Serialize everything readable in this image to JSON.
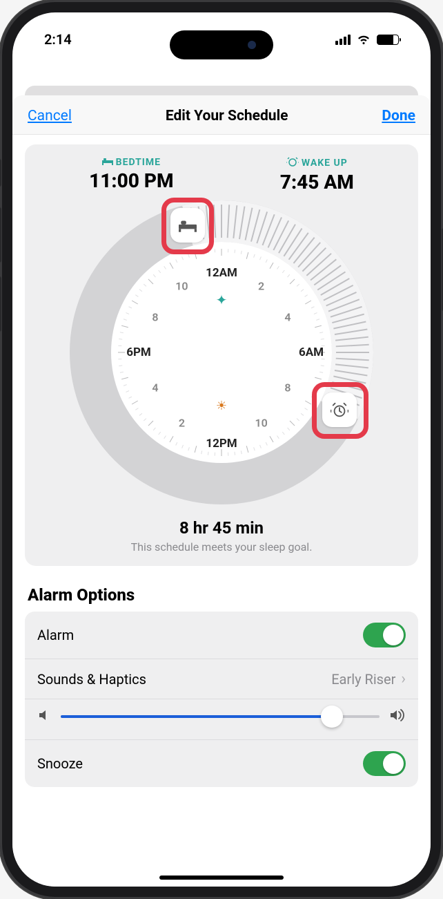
{
  "status": {
    "time": "2:14"
  },
  "modal": {
    "cancel": "Cancel",
    "title": "Edit Your Schedule",
    "done": "Done"
  },
  "bedtime": {
    "label": "BEDTIME",
    "time": "11:00 PM"
  },
  "wakeup": {
    "label": "WAKE UP",
    "time": "7:45 AM"
  },
  "clock": {
    "top": "12AM",
    "bottom": "12PM",
    "left": "6PM",
    "right": "6AM",
    "h10a": "10",
    "h2a": "2",
    "h8a": "8",
    "h4a": "4",
    "h10b": "10",
    "h2b": "2",
    "h8b": "8",
    "h4b": "4"
  },
  "duration": {
    "main": "8 hr 45 min",
    "sub": "This schedule meets your sleep goal."
  },
  "alarm_section_title": "Alarm Options",
  "options": {
    "alarm_label": "Alarm",
    "sounds_label": "Sounds & Haptics",
    "sounds_value": "Early Riser",
    "snooze_label": "Snooze"
  },
  "toggles": {
    "alarm": true,
    "snooze": true
  },
  "volume_percent": 85,
  "colors": {
    "accent": "#007aff",
    "teal": "#2aa59a",
    "toggle_on": "#2ea44f",
    "highlight": "#e43a4a"
  },
  "dial": {
    "bedtime_angle_deg": -15,
    "wakeup_angle_deg": 116
  }
}
